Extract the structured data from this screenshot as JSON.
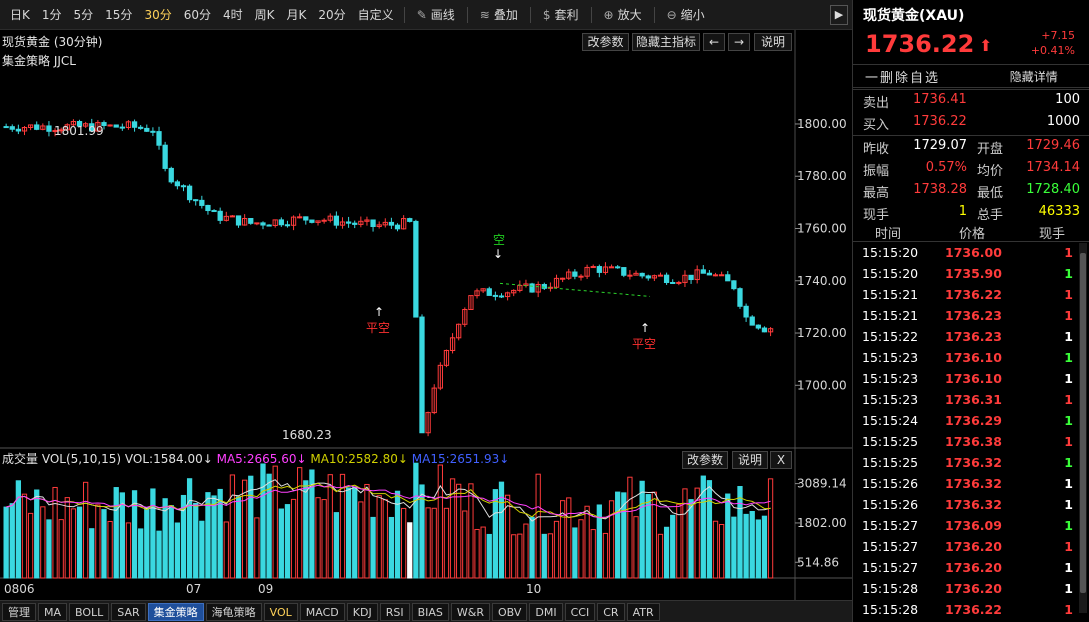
{
  "toolbar": {
    "timeframes": [
      "日K",
      "1分",
      "5分",
      "15分",
      "30分",
      "60分",
      "4时",
      "周K",
      "月K",
      "20分",
      "自定义"
    ],
    "active_timeframe": "30分",
    "tools": [
      {
        "label": "画线",
        "icon": "pencil-icon"
      },
      {
        "label": "叠加",
        "icon": "stack-icon"
      },
      {
        "label": "套利",
        "icon": "money-bag-icon"
      },
      {
        "label": "放大",
        "icon": "zoom-in-icon"
      },
      {
        "label": "缩小",
        "icon": "zoom-out-icon"
      }
    ],
    "collapse": "▶"
  },
  "chart_header": {
    "title": "现货黄金 (30分钟)",
    "strategy": "集金策略 JJCL",
    "buttons": [
      "改参数",
      "隐藏主指标",
      "←",
      "→",
      "说明"
    ]
  },
  "volume_header": {
    "label": "成交量 VOL(5,10,15) VOL:1584.00↓",
    "ma5": "MA5:2665.60↓",
    "ma10": "MA10:2582.80↓",
    "ma15": "MA15:2651.93↓",
    "buttons": [
      "改参数",
      "说明",
      "X"
    ]
  },
  "chart_data": {
    "type": "candlestick",
    "price_axis": {
      "ticks": [
        1800,
        1780,
        1760,
        1740,
        1720,
        1700
      ],
      "labels": [
        "1800.00",
        "1780.00",
        "1760.00",
        "1740.00",
        "1720.00",
        "1700.00"
      ],
      "range": [
        1676,
        1813
      ]
    },
    "annotations": {
      "high": "1801.99",
      "low": "1680.23"
    },
    "signals": [
      {
        "text": "平空",
        "color": "#ff3030"
      },
      {
        "text": "空",
        "color": "#20d020"
      },
      {
        "text": "平空",
        "color": "#ff3030"
      }
    ],
    "volume_axis": {
      "labels": [
        "3089.14",
        "1802.00",
        "514.86"
      ],
      "range": [
        0,
        3600
      ]
    },
    "x_labels": [
      "0806",
      "07",
      "09",
      "10"
    ],
    "colors": {
      "up": "#ff3b3b",
      "down": "#3ad8e0",
      "ma5": "#ffffff",
      "ma10": "#ffd200",
      "ma15": "#ff3cff",
      "vol_ma5": "#e0e0e0",
      "vol_ma10": "#d0d000",
      "vol_ma15": "#ff40ff"
    }
  },
  "bottom_tabs": [
    "管理",
    "MA",
    "BOLL",
    "SAR",
    "集金策略",
    "海龟策略",
    "VOL",
    "MACD",
    "KDJ",
    "RSI",
    "BIAS",
    "W&R",
    "OBV",
    "DMI",
    "CCI",
    "CR",
    "ATR"
  ],
  "active_tab": "集金策略",
  "right_panel": {
    "title": "现货黄金(XAU)",
    "price": "1736.22",
    "change": "+7.15",
    "change_pct": "+0.41%",
    "delete_fav": "一删除自选",
    "hide_detail": "隐藏详情",
    "bidask": [
      {
        "label": "卖出",
        "price": "1736.41",
        "vol": "100"
      },
      {
        "label": "买入",
        "price": "1736.22",
        "vol": "1000"
      }
    ],
    "stats": [
      {
        "l1": "昨收",
        "v1": "1729.07",
        "c1": "#ffffff",
        "l2": "开盘",
        "v2": "1729.46",
        "c2": "#ff3b3b"
      },
      {
        "l1": "振幅",
        "v1": "0.57%",
        "c1": "#ff3b3b",
        "l2": "均价",
        "v2": "1734.14",
        "c2": "#ff3b3b"
      },
      {
        "l1": "最高",
        "v1": "1738.28",
        "c1": "#ff3b3b",
        "l2": "最低",
        "v2": "1728.40",
        "c2": "#3aff3a"
      },
      {
        "l1": "现手",
        "v1": "1",
        "c1": "#ffff00",
        "l2": "总手",
        "v2": "46333",
        "c2": "#ffff00"
      }
    ],
    "tick_headers": [
      "时间",
      "价格",
      "现手"
    ],
    "ticks": [
      {
        "time": "15:15:20",
        "price": "1736.00",
        "vol": "1",
        "vc": "#ff3b3b"
      },
      {
        "time": "15:15:20",
        "price": "1735.90",
        "vol": "1",
        "vc": "#3aff3a"
      },
      {
        "time": "15:15:21",
        "price": "1736.22",
        "vol": "1",
        "vc": "#ff3b3b"
      },
      {
        "time": "15:15:21",
        "price": "1736.23",
        "vol": "1",
        "vc": "#ff3b3b"
      },
      {
        "time": "15:15:22",
        "price": "1736.23",
        "vol": "1",
        "vc": "#ffffff"
      },
      {
        "time": "15:15:23",
        "price": "1736.10",
        "vol": "1",
        "vc": "#3aff3a"
      },
      {
        "time": "15:15:23",
        "price": "1736.10",
        "vol": "1",
        "vc": "#ffffff"
      },
      {
        "time": "15:15:23",
        "price": "1736.31",
        "vol": "1",
        "vc": "#ff3b3b"
      },
      {
        "time": "15:15:24",
        "price": "1736.29",
        "vol": "1",
        "vc": "#3aff3a"
      },
      {
        "time": "15:15:25",
        "price": "1736.38",
        "vol": "1",
        "vc": "#ff3b3b"
      },
      {
        "time": "15:15:25",
        "price": "1736.32",
        "vol": "1",
        "vc": "#3aff3a"
      },
      {
        "time": "15:15:26",
        "price": "1736.32",
        "vol": "1",
        "vc": "#ffffff"
      },
      {
        "time": "15:15:26",
        "price": "1736.32",
        "vol": "1",
        "vc": "#ffffff"
      },
      {
        "time": "15:15:27",
        "price": "1736.09",
        "vol": "1",
        "vc": "#3aff3a"
      },
      {
        "time": "15:15:27",
        "price": "1736.20",
        "vol": "1",
        "vc": "#ff3b3b"
      },
      {
        "time": "15:15:27",
        "price": "1736.20",
        "vol": "1",
        "vc": "#ffffff"
      },
      {
        "time": "15:15:28",
        "price": "1736.20",
        "vol": "1",
        "vc": "#ffffff"
      },
      {
        "time": "15:15:28",
        "price": "1736.22",
        "vol": "1",
        "vc": "#ff3b3b"
      }
    ]
  }
}
